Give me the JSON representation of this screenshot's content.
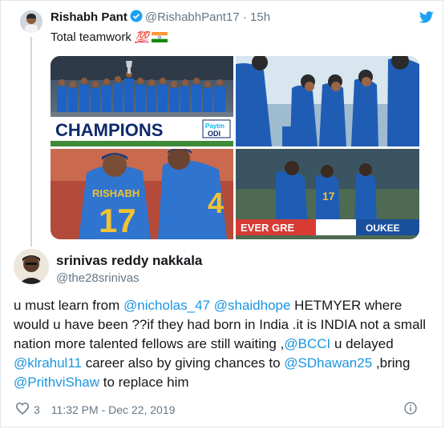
{
  "parent_tweet": {
    "display_name": "Rishabh Pant",
    "handle": "@RishabhPant17",
    "separator": "·",
    "time": "15h",
    "text": "Total teamwork",
    "emoji": "💯",
    "flag": "india-flag",
    "photos": {
      "top_left_banner": "CHAMPIONS",
      "top_left_sponsor": "Paytm",
      "top_left_sponsor_badge": "ODI",
      "bottom_left_jersey_name": "RISHABH",
      "bottom_left_jersey_number": "17",
      "bottom_left_jersey_number_2": "4",
      "bottom_right_jersey_number": "17",
      "bottom_right_board_left": "EVER GRE",
      "bottom_right_board_right": "OUKEE"
    }
  },
  "reply_tweet": {
    "display_name": "srinivas reddy nakkala",
    "handle": "@the28srinivas",
    "segments": [
      {
        "t": "u must learn from ",
        "link": false
      },
      {
        "t": "@nicholas_47",
        "link": true
      },
      {
        "t": " ",
        "link": false
      },
      {
        "t": "@shaidhope",
        "link": true
      },
      {
        "t": " HETMYER where would u have been ??if they had born in India .it is INDIA not a small nation more talented fellows are still waiting ,",
        "link": false
      },
      {
        "t": "@BCCI",
        "link": true
      },
      {
        "t": " u delayed ",
        "link": false
      },
      {
        "t": "@klrahul11",
        "link": true
      },
      {
        "t": " career also by giving chances to ",
        "link": false
      },
      {
        "t": "@SDhawan25",
        "link": true
      },
      {
        "t": " ,bring ",
        "link": false
      },
      {
        "t": "@PrithviShaw",
        "link": true
      },
      {
        "t": " to replace him",
        "link": false
      }
    ],
    "like_count": "3",
    "timestamp": "11:32 PM - Dec 22, 2019"
  },
  "colors": {
    "link": "#1b95e0",
    "muted": "#657786",
    "verified": "#1da1f2",
    "india_blue": "#1e63c4"
  },
  "icons": [
    "verified-badge-icon",
    "twitter-bird-icon",
    "heart-icon",
    "info-icon"
  ]
}
